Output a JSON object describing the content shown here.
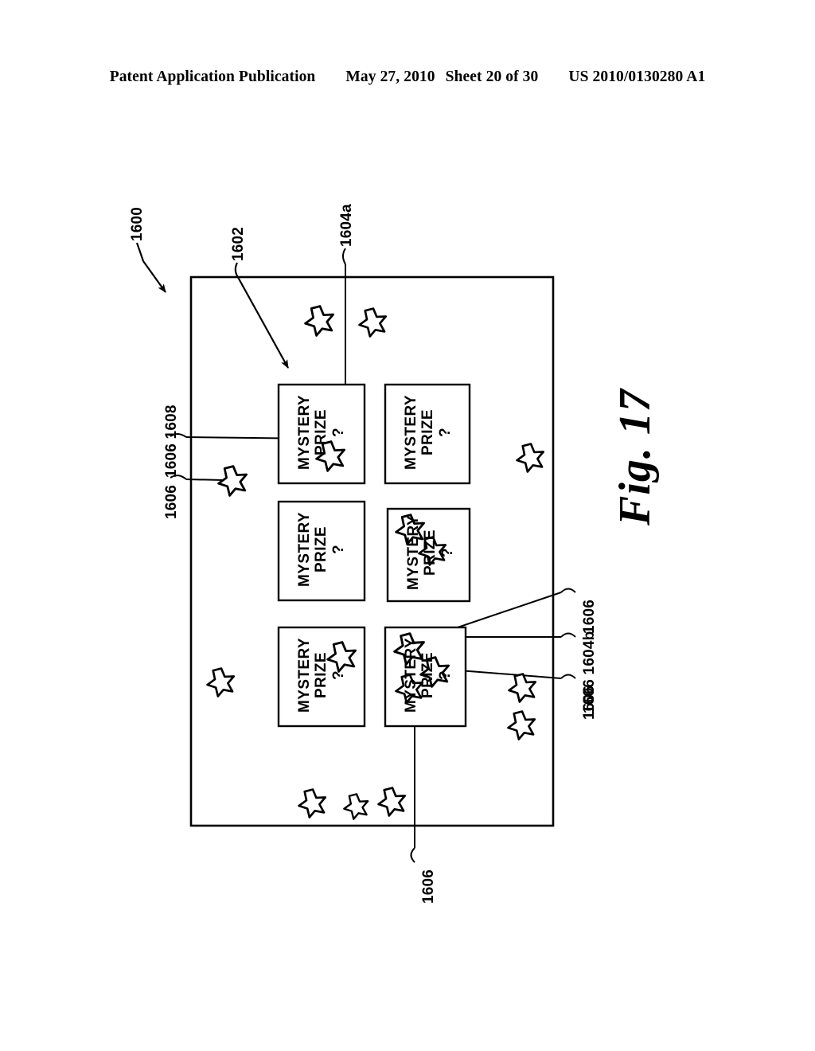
{
  "page_header": {
    "publication": "Patent Application Publication",
    "date": "May 27, 2010",
    "sheet": "Sheet 20 of 30",
    "publication_number": "US 2010/0130280 A1"
  },
  "figure": {
    "caption": "Fig. 17",
    "reference_numerals": {
      "display_screen": "1600",
      "game_area": "1602",
      "prize_element_a": "1604a",
      "prize_element_b": "1604b",
      "star_symbol": "1606",
      "prize_indicator": "1608",
      "left_upper_pair": "1606 1608",
      "left_lower": "1606",
      "right_upper": "1606",
      "right_middle": "1606 1604b",
      "right_lower": "1606",
      "bottom": "1606"
    },
    "prize_tiles": [
      {
        "id": "tile-1",
        "line1": "MYSTERY",
        "line2": "PRIZE",
        "line3": "?",
        "stars": 1
      },
      {
        "id": "tile-2",
        "line1": "MYSTERY",
        "line2": "PRIZE",
        "line3": "?",
        "stars": 0
      },
      {
        "id": "tile-3",
        "line1": "MYSTERY",
        "line2": "PRIZE",
        "line3": "?",
        "stars": 0
      },
      {
        "id": "tile-4",
        "line1": "MYSTERY",
        "line2": "PRIZE",
        "line3": "?",
        "stars": 2
      },
      {
        "id": "tile-5",
        "line1": "MYSTERY",
        "line2": "PRIZE",
        "line3": "?",
        "stars": 1
      },
      {
        "id": "tile-6",
        "line1": "MYSTERY",
        "line2": "PRIZE",
        "line3": "?",
        "stars": 3
      }
    ],
    "colors": {
      "ink": "#000000",
      "paper": "#ffffff"
    }
  }
}
